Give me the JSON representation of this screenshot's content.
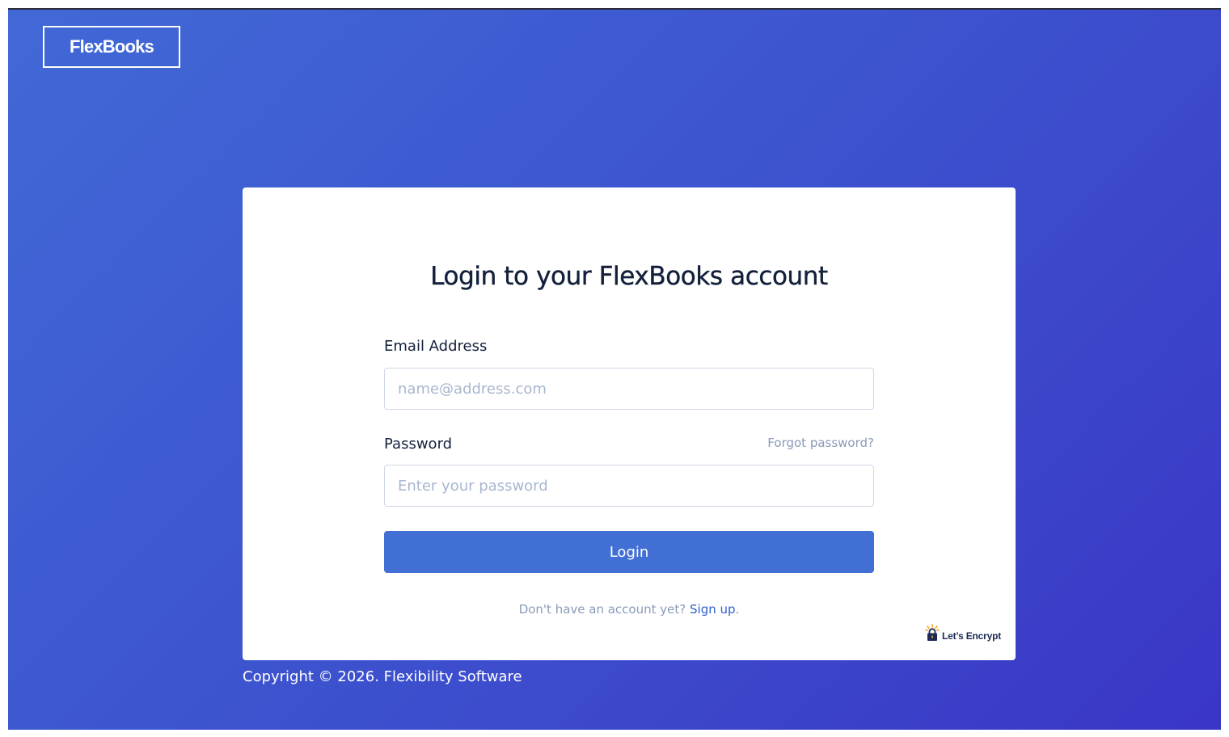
{
  "brand": {
    "logo_text": "FlexBooks"
  },
  "login": {
    "title": "Login to your FlexBooks account",
    "email_label": "Email Address",
    "email_placeholder": "name@address.com",
    "email_value": "",
    "password_label": "Password",
    "password_placeholder": "Enter your password",
    "password_value": "",
    "forgot_password": "Forgot password?",
    "login_button": "Login",
    "signup_prompt": "Don't have an account yet?",
    "signup_link": "Sign up",
    "signup_suffix": "."
  },
  "badge": {
    "text": "Let’s Encrypt",
    "icon": "lets-encrypt-icon"
  },
  "footer": {
    "copyright": "Copyright © 2026. Flexibility Software"
  },
  "colors": {
    "background_gradient_start": "#4169d6",
    "background_gradient_end": "#3a36c6",
    "button": "#416fd4",
    "link": "#2f5fc8",
    "muted_text": "#8a9ab8",
    "heading_text": "#13203b"
  }
}
